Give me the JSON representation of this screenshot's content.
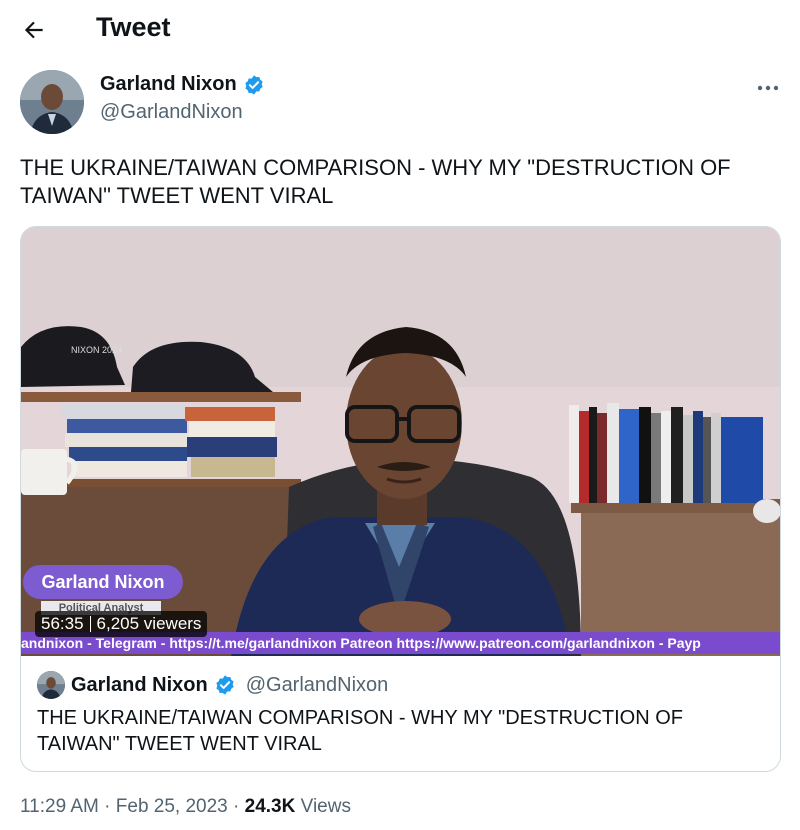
{
  "header": {
    "title": "Tweet"
  },
  "tweet": {
    "author_name": "Garland Nixon",
    "author_handle": "@GarlandNixon",
    "text": "THE UKRAINE/TAIWAN COMPARISON - WHY MY \"DESTRUCTION OF TAIWAN\" TWEET WENT VIRAL",
    "time": "11:29 AM",
    "date": "Feb 25, 2023",
    "views_count": "24.3K",
    "views_label": "Views"
  },
  "video": {
    "name_badge": "Garland Nixon",
    "sub_badge": "Political Analyst",
    "ticker": "andnixon - Telegram - https://t.me/garlandnixon Patreon https://www.patreon.com/garlandnixon - Payp",
    "duration": "56:35",
    "viewers": "6,205 viewers",
    "hat_text": "NIXON 2024"
  },
  "quote": {
    "author_name": "Garland Nixon",
    "author_handle": "@GarlandNixon",
    "text": "THE UKRAINE/TAIWAN COMPARISON - WHY MY \"DESTRUCTION OF TAIWAN\" TWEET WENT VIRAL"
  },
  "colors": {
    "verified": "#1d9bf0",
    "secondary_text": "#536471",
    "video_accent": "#7d5bd0"
  }
}
